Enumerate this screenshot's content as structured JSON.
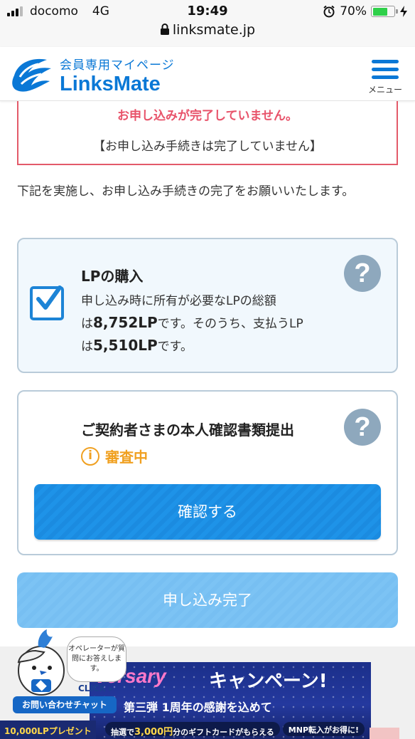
{
  "status_bar": {
    "carrier": "docomo",
    "network": "4G",
    "time": "19:49",
    "battery": "70%",
    "url": "linksmate.jp"
  },
  "header": {
    "logo_sub": "会員専用マイページ",
    "logo_main": "LinksMate",
    "menu_label": "メニュー"
  },
  "alert": {
    "title": "お申し込みが完了していません。",
    "subtitle": "【お申し込み手続きは完了していません】"
  },
  "description": "下記を実施し、お申し込み手続きの完了をお願いいたします。",
  "lp_card": {
    "title": "LPの購入",
    "line1": "申し込み時に所有が必要なLPの総額",
    "prefix1": "は",
    "total_lp": "8,752LP",
    "mid": "です。そのうち、支払うLP",
    "prefix2": "は",
    "pay_lp": "5,510LP",
    "suffix": "です。",
    "checked": true
  },
  "id_card": {
    "title": "ご契約者さまの本人確認書類提出",
    "status": "審査中",
    "confirm_button": "確認する"
  },
  "complete_button": "申し込み完了",
  "chat": {
    "bubble": "オペレーターが質問にお答えします。",
    "click": "CLICK",
    "label": "お問い合わせチャット"
  },
  "banner": {
    "title_part1": "versary",
    "title_part2": "キャンペーン!",
    "subtitle": "第三弾 1周年の感謝を込めて",
    "left_text": "10,000LPプレゼント",
    "pill1_prefix": "抽選で",
    "pill1_amount": "3,000円",
    "pill1_suffix": "分のギフトカードがもらえる",
    "pill2": "MNP転入がお得に!"
  },
  "colors": {
    "brand_blue": "#0a78d6",
    "alert_red": "#e8536a",
    "status_orange": "#f0a020",
    "button_blue": "#1e93e8",
    "button_light": "#7cc3f4"
  },
  "icons": [
    "signal-icon",
    "lock-icon",
    "alarm-icon",
    "battery-icon",
    "menu-icon",
    "checkbox-icon",
    "help-icon",
    "info-icon",
    "chat-bird-icon"
  ]
}
